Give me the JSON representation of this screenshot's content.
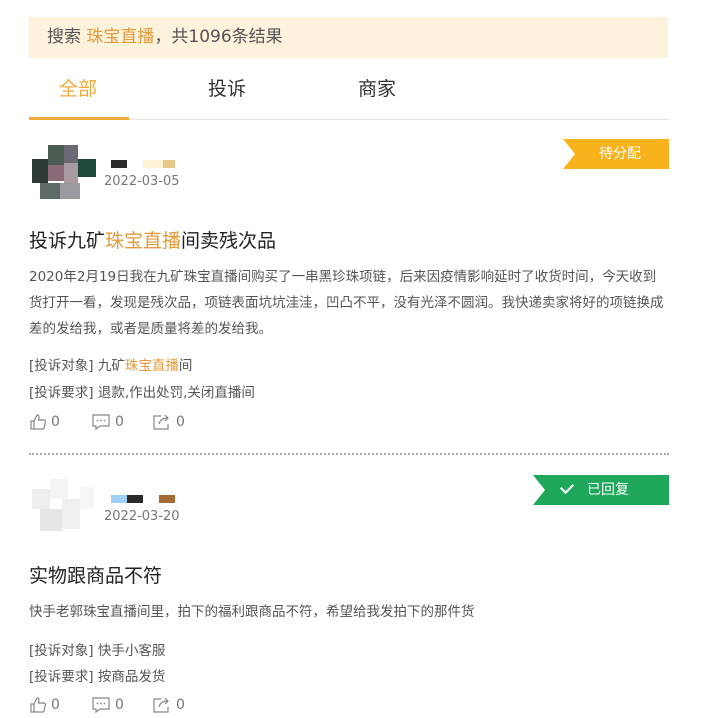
{
  "search": {
    "prefix": "搜索 ",
    "keyword": "珠宝直播",
    "suffix": "，共1096条结果"
  },
  "tabs": [
    {
      "label": "全部",
      "active": true
    },
    {
      "label": "投诉",
      "active": false
    },
    {
      "label": "商家",
      "active": false
    }
  ],
  "complaints": [
    {
      "date": "2022-03-05",
      "status": "待分配",
      "title_pre": "投诉九矿",
      "title_kw": "珠宝直播",
      "title_post": "间卖残次品",
      "body": "2020年2月19日我在九矿珠宝直播间购买了一串黑珍珠项链，后来因疫情影响延时了收货时间，今天收到货打开一看，发现是残次品，项链表面坑坑洼洼，凹凸不平，没有光泽不圆润。我快递卖家将好的项链换成差的发给我，或者是质量将差的发给我。",
      "target_label": "[投诉对象]",
      "target_pre": "九矿",
      "target_kw": "珠宝直播",
      "target_post": "间",
      "demand_label": "[投诉要求]",
      "demand": "退款,作出处罚,关闭直播间",
      "likes": "0",
      "comments": "0",
      "shares": "0"
    },
    {
      "date": "2022-03-20",
      "status": "已回复",
      "title": "实物跟商品不符",
      "body": "快手老郭珠宝直播间里，拍下的福利跟商品不符，希望给我发拍下的那件货",
      "target_label": "[投诉对象]",
      "target": "快手小客服",
      "demand_label": "[投诉要求]",
      "demand": "按商品发货",
      "likes": "0",
      "comments": "0",
      "shares": "0"
    }
  ],
  "colors": {
    "accent": "#f2a93b",
    "pending": "#f8b21c",
    "replied": "#1fa85b",
    "banner": "#fdf2dc"
  },
  "icons": [
    "thumbs-up-icon",
    "comment-icon",
    "share-icon",
    "check-icon"
  ]
}
